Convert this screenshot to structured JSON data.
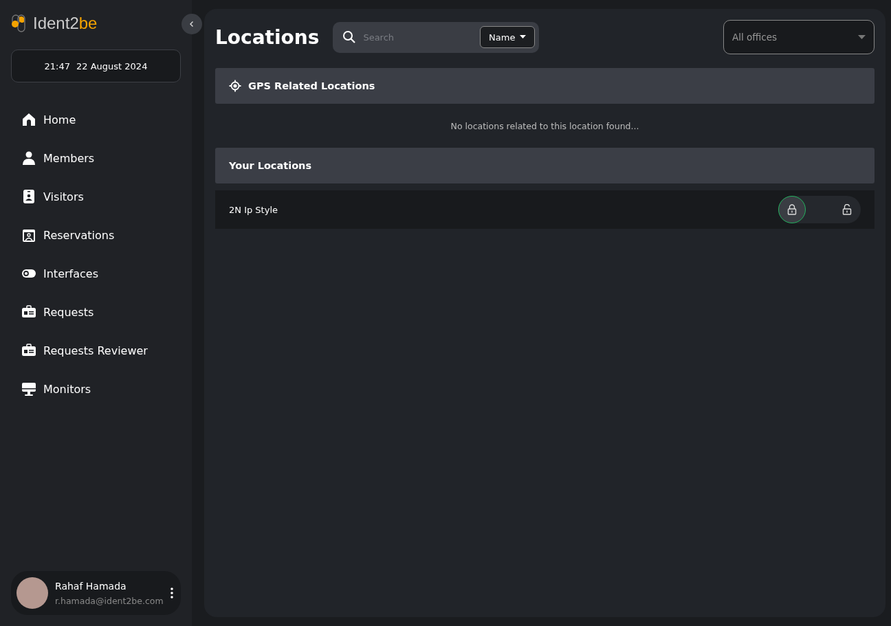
{
  "logo": {
    "text": "Ident2",
    "accent": "be"
  },
  "clock": {
    "time": "21:47",
    "date": "22 August 2024"
  },
  "sidebar": {
    "items": [
      {
        "label": "Home"
      },
      {
        "label": "Members"
      },
      {
        "label": "Visitors"
      },
      {
        "label": "Reservations"
      },
      {
        "label": "Interfaces"
      },
      {
        "label": "Requests"
      },
      {
        "label": "Requests Reviewer"
      },
      {
        "label": "Monitors"
      }
    ]
  },
  "user": {
    "name": "Rahaf Hamada",
    "email": "r.hamada@ident2be.com"
  },
  "page": {
    "title": "Locations"
  },
  "search": {
    "placeholder": "Search",
    "filter": "Name"
  },
  "office_select": {
    "placeholder": "All offices"
  },
  "gps_section": {
    "title": "GPS Related Locations",
    "empty_message": "No locations related to this location found..."
  },
  "your_locations": {
    "title": "Your Locations",
    "rows": [
      {
        "name": "2N Ip Style",
        "lock_options": [
          {
            "kind": "locked",
            "selected": true
          },
          {
            "kind": "unlocked",
            "selected": false
          }
        ]
      }
    ]
  }
}
